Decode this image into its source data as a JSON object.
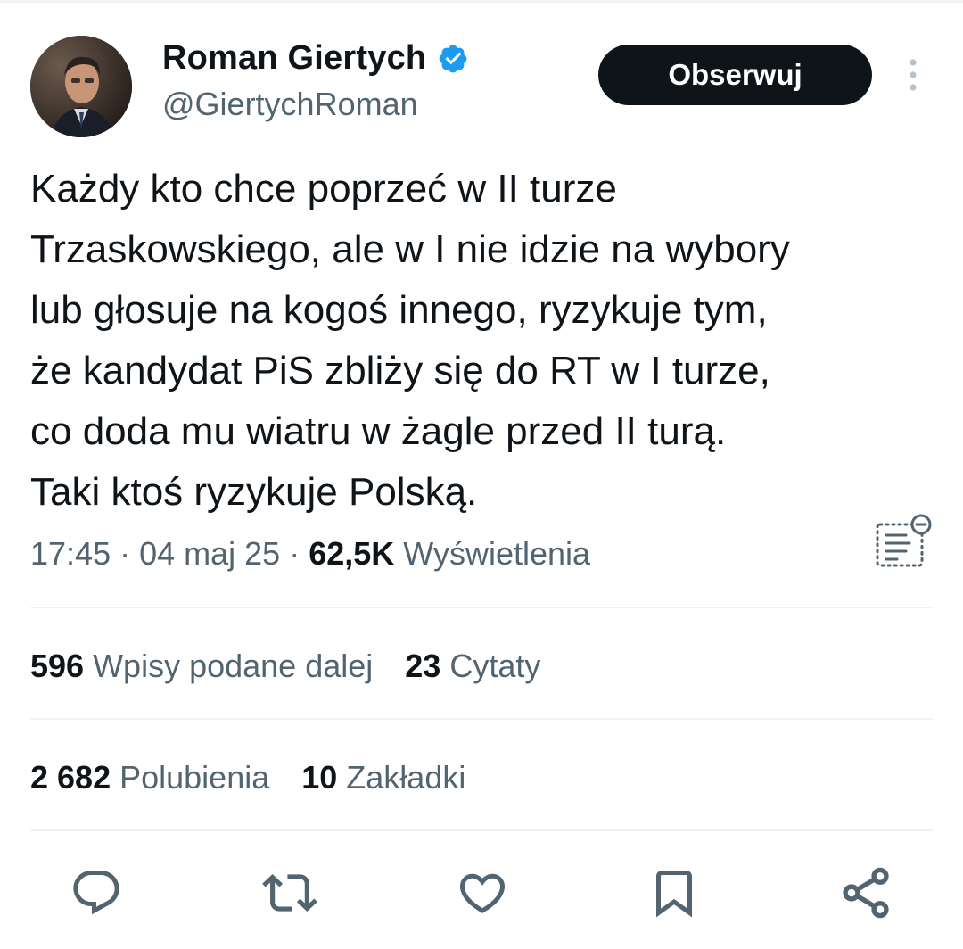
{
  "author": {
    "name": "Roman Giertych",
    "handle": "@GiertychRoman",
    "verified": true,
    "avatar_icon": "profile-photo"
  },
  "follow_button": {
    "label": "Obserwuj"
  },
  "more_icon": "more-vertical-icon",
  "tweet": {
    "text": "Każdy kto chce poprzeć w II turze\nTrzaskowskiego, ale w I nie idzie na wybory\nlub głosuje na kogoś innego,  ryzykuje tym,\nże kandydat PiS zbliży się do RT w I turze,\nco doda mu wiatru w żagle przed II turą.\nTaki ktoś ryzykuje Polską."
  },
  "meta": {
    "time": "17:45",
    "separator": " · ",
    "date": "04 maj 25",
    "views_count": "62,5K",
    "views_label": " Wyświetlenia"
  },
  "stats": {
    "reposts": {
      "count": "596",
      "label": "Wpisy podane dalej"
    },
    "quotes": {
      "count": "23",
      "label": "Cytaty"
    },
    "likes": {
      "count": "2 682",
      "label": "Polubienia"
    },
    "bookmarks": {
      "count": "10",
      "label": "Zakładki"
    }
  },
  "actions": [
    "reply-icon",
    "retweet-icon",
    "like-icon",
    "bookmark-icon",
    "share-icon"
  ],
  "colors": {
    "text": "#0f1419",
    "secondary": "#536471",
    "verified": "#1d9bf0",
    "button_bg": "#0f1419",
    "divider": "#eff3f4"
  }
}
